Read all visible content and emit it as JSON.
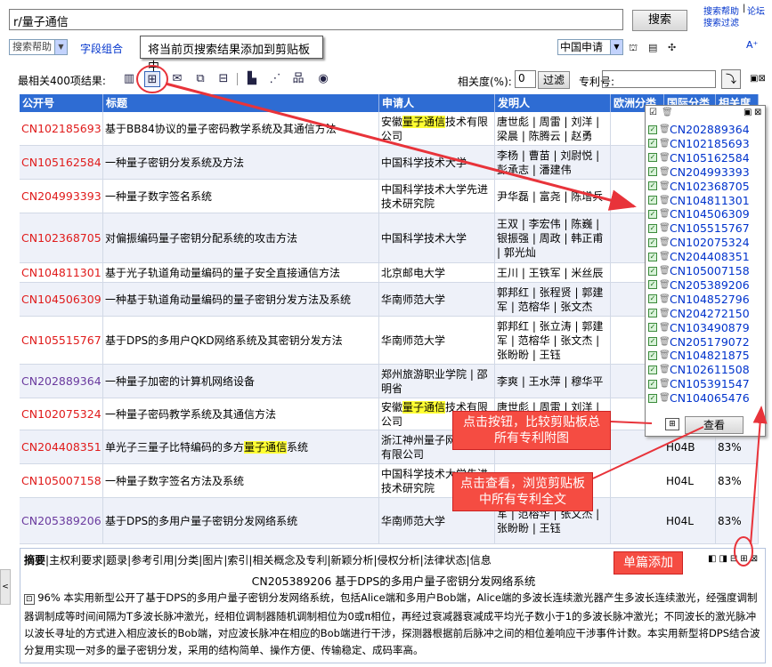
{
  "search": {
    "query": "r/量子通信",
    "button": "搜索",
    "help_links": [
      "搜索帮助",
      "论坛",
      "搜索过滤"
    ],
    "help_select": "搜索帮助",
    "combo_link": "字段组合",
    "tooltip": "将当前页搜索结果添加到剪贴板中",
    "country_select": "中国申请",
    "font_icon": "A⁺"
  },
  "toolbar": {
    "result_label": "最相关400项结果:",
    "relevance_label": "相关度(%):",
    "relevance_value": "0",
    "filter_button": "过滤",
    "patent_no_label": "专利号:"
  },
  "table": {
    "headers": [
      "公开号",
      "标题",
      "申请人",
      "发明人",
      "欧洲分类",
      "国际分类",
      "相关度"
    ],
    "rows": [
      {
        "pn": "CN102185693",
        "title": "基于BB84协议的量子密码教学系统及其通信方法",
        "applicant": [
          "安徽",
          "量子通信",
          "技术有限公司"
        ],
        "inventors": "唐世彪 | 周雷 | 刘洋 | 梁晨 | 陈腾云 | 赵勇",
        "ipc": "",
        "rel": ""
      },
      {
        "pn": "CN105162584",
        "title": "一种量子密钥分发系统及方法",
        "applicant": [
          "中国科学技术大学"
        ],
        "inventors": "李杨 | 曹苗 | 刘尉悦 | 彭承志 | 潘建伟",
        "ipc": "",
        "rel": ""
      },
      {
        "pn": "CN204993393",
        "title": "一种量子数字签名系统",
        "applicant": [
          "中国科学技术大学先进技术研究院"
        ],
        "inventors": "尹华磊 | 富尧 | 陈增兵",
        "ipc": "",
        "rel": ""
      },
      {
        "pn": "CN102368705",
        "title": "对偏振编码量子密钥分配系统的攻击方法",
        "applicant": [
          "中国科学技术大学"
        ],
        "inventors": "王双 | 李宏伟 | 陈巍 | 银振强 | 周政 | 韩正甫 | 郭光灿",
        "ipc": "",
        "rel": ""
      },
      {
        "pn": "CN104811301",
        "title": "基于光子轨道角动量编码的量子安全直接通信方法",
        "applicant": [
          "北京邮电大学"
        ],
        "inventors": "王川 | 王铁军 | 米丝辰",
        "ipc": "",
        "rel": ""
      },
      {
        "pn": "CN104506309",
        "title": "一种基于轨道角动量编码的量子密钥分发方法及系统",
        "applicant": [
          "华南师范大学"
        ],
        "inventors": "郭邦红 | 张程贤 | 郭建军 | 范榕华 | 张文杰",
        "ipc": "",
        "rel": ""
      },
      {
        "pn": "CN105515767",
        "title": "基于DPS的多用户QKD网络系统及其密钥分发方法",
        "applicant": [
          "华南师范大学"
        ],
        "inventors": "郭邦红 | 张立涛 | 郭建军 | 范榕华 | 张文杰 | 张盼盼 | 王钰",
        "ipc": "",
        "rel": ""
      },
      {
        "pn": "CN202889364",
        "title": "一种量子加密的计算机网络设备",
        "applicant": [
          "郑州旅游职业学院 | 邵明省"
        ],
        "inventors": "李爽 | 王水萍 | 穆华平",
        "ipc": "",
        "rel": ""
      },
      {
        "pn": "CN102075324",
        "title": "一种量子密码教学系统及其通信方法",
        "applicant": [
          "安徽",
          "量子通信",
          "技术有限公司"
        ],
        "inventors": "唐世彪 | 周雷 | 刘洋 | 梁晨",
        "ipc": "",
        "rel": ""
      },
      {
        "pn": "CN204408351",
        "title": [
          "单光子三量子比特编码的多方",
          "量子通信",
          "系统"
        ],
        "applicant": [
          "浙江神州量子网络科技有限公司"
        ],
        "inventors": "",
        "ipc": "H04B",
        "rel": "83%"
      },
      {
        "pn": "CN105007158",
        "title": "一种量子数字签名方法及系统",
        "applicant": [
          "中国科学技术大学先进技术研究院"
        ],
        "inventors": "",
        "ipc": "H04L",
        "rel": "83%"
      },
      {
        "pn": "CN205389206",
        "title": "基于DPS的多用户量子密钥分发网络系统",
        "applicant": [
          "华南师范大学"
        ],
        "inventors": "军 | 范榕华 | 张文杰 | 张盼盼 | 王钰",
        "ipc": "H04L",
        "rel": "83%"
      }
    ]
  },
  "clipboard": {
    "items": [
      "CN202889364",
      "CN102185693",
      "CN105162584",
      "CN204993393",
      "CN102368705",
      "CN104811301",
      "CN104506309",
      "CN105515767",
      "CN102075324",
      "CN204408351",
      "CN105007158",
      "CN205389206",
      "CN104852796",
      "CN204272150",
      "CN103490879",
      "CN205179072",
      "CN104821875",
      "CN102611508",
      "CN105391547",
      "CN104065476"
    ],
    "view_button": "查看"
  },
  "detail": {
    "tabs": [
      "摘要",
      "主权利要求",
      "题录",
      "参考引用",
      "分类",
      "图片",
      "索引",
      "相关概念及专利",
      "新颖分析",
      "侵权分析",
      "法律状态",
      "信息"
    ],
    "title": "CN205389206   基于DPS的多用户量子密钥分发网络系统",
    "relevance": "96%",
    "abstract": "本实用新型公开了基于DPS的多用户量子密钥分发网络系统，包括Alice端和多用户Bob端，Alice端的多波长连续激光器产生多波长连续激光，经强度调制器调制成等时间间隔为T多波长脉冲激光，经相位调制器随机调制相位为0或π相位，再经过衰减器衰减成平均光子数小于1的多波长脉冲激光；不同波长的激光脉冲以波长寻址的方式进入相应波长的Bob端，对应波长脉冲在相应的Bob端进行干涉，探测器根据前后脉冲之间的相位差响应干涉事件计数。本实用新型将DPS结合波分复用实现一对多的量子密钥分发，采用的结构简单、操作方便、传输稳定、成码率高。"
  },
  "annotations": {
    "compare": "点击按钮，比较剪贴板总所有专利附图",
    "view": "点击查看，浏览剪贴板中所有专利全文",
    "single": "单篇添加"
  },
  "colors": {
    "header_bg": "#2e6cd3",
    "callout_bg": "#f54c42",
    "arrow": "#e8333a",
    "highlight": "#ffff33"
  }
}
